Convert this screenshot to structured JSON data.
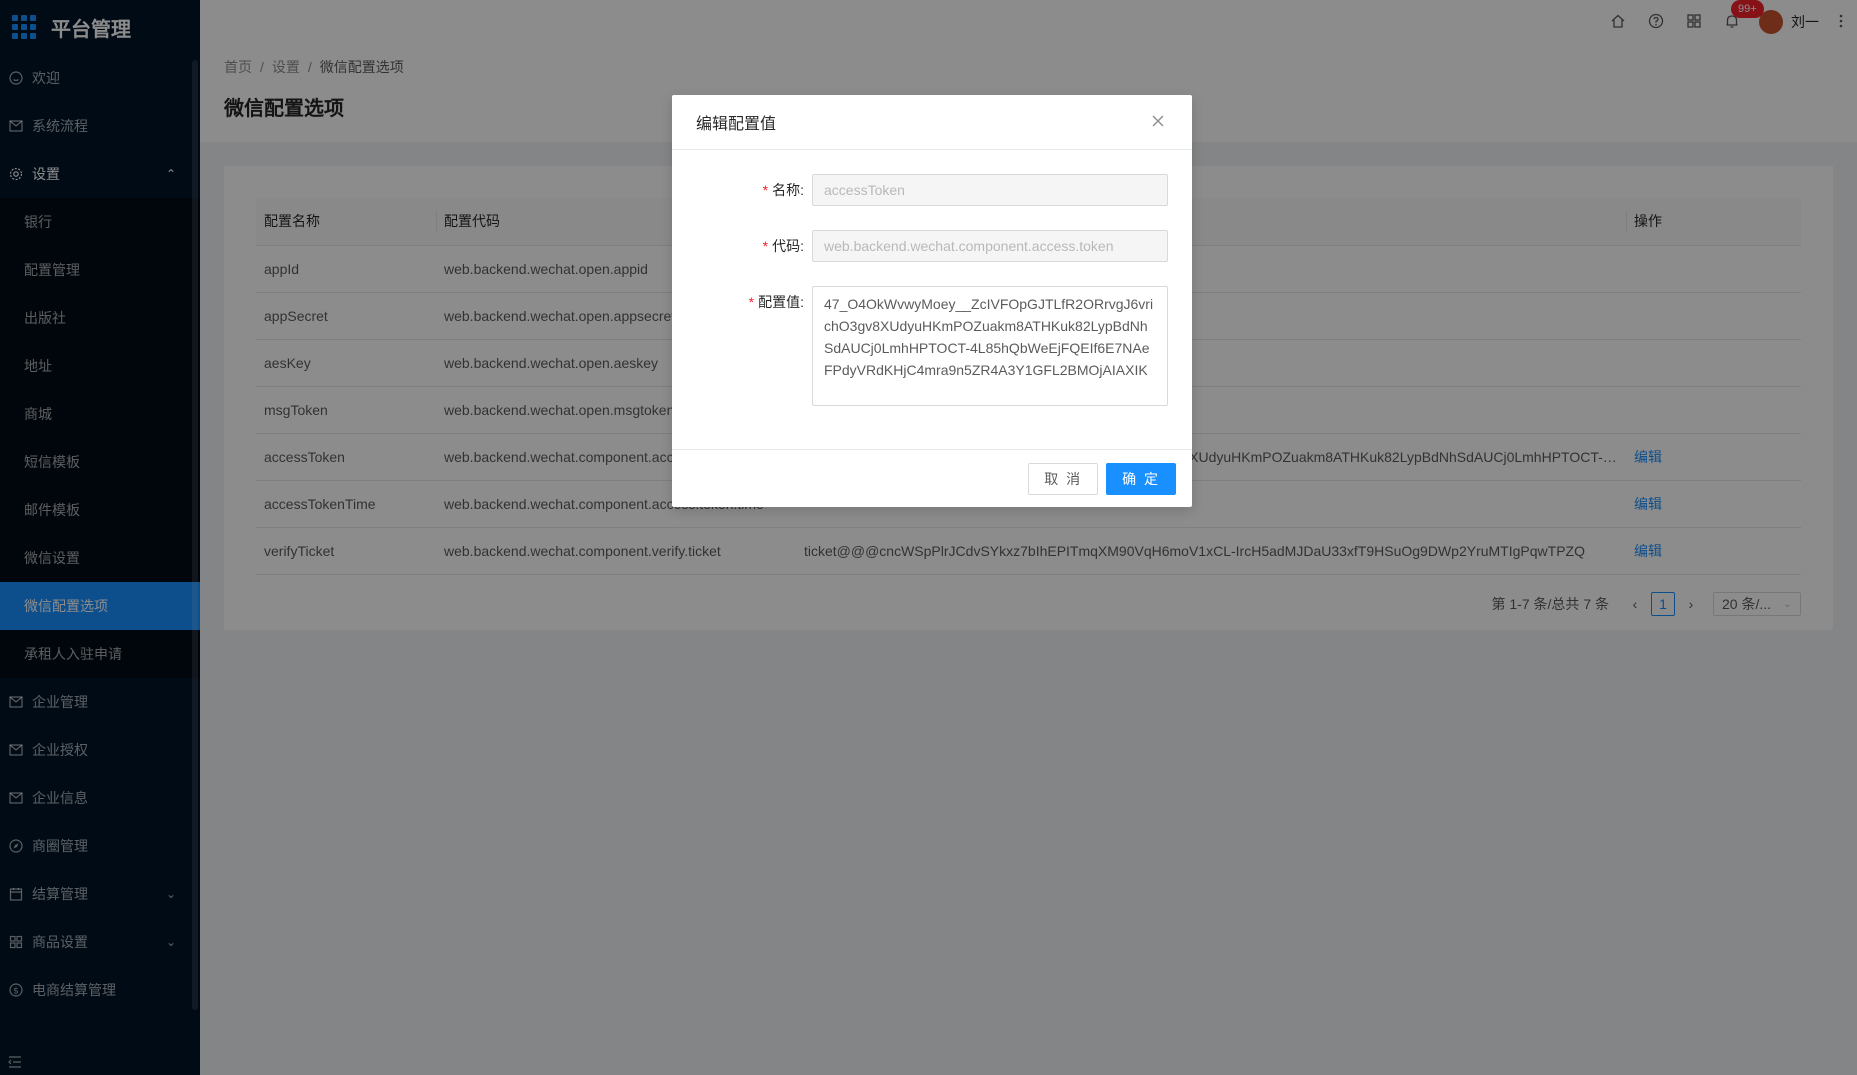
{
  "app": {
    "title": "平台管理"
  },
  "sidebar": {
    "items": [
      {
        "label": "欢迎",
        "icon": "smile-icon"
      },
      {
        "label": "系统流程",
        "icon": "mail-icon"
      },
      {
        "label": "设置",
        "icon": "gear-icon"
      }
    ],
    "settings_children": [
      {
        "label": "银行"
      },
      {
        "label": "配置管理"
      },
      {
        "label": "出版社"
      },
      {
        "label": "地址"
      },
      {
        "label": "商城"
      },
      {
        "label": "短信模板"
      },
      {
        "label": "邮件模板"
      },
      {
        "label": "微信设置"
      },
      {
        "label": "微信配置选项"
      },
      {
        "label": "承租人入驻申请"
      }
    ],
    "items_after": [
      {
        "label": "企业管理",
        "icon": "mail-icon"
      },
      {
        "label": "企业授权",
        "icon": "mail-icon"
      },
      {
        "label": "企业信息",
        "icon": "mail-icon"
      },
      {
        "label": "商圈管理",
        "icon": "compass-icon"
      },
      {
        "label": "结算管理",
        "icon": "calendar-icon"
      },
      {
        "label": "商品设置",
        "icon": "appstore-icon"
      },
      {
        "label": "电商结算管理",
        "icon": "dollar-icon"
      }
    ]
  },
  "header": {
    "badge": "99+",
    "username": "刘一"
  },
  "breadcrumb": [
    "首页",
    "设置",
    "微信配置选项"
  ],
  "page": {
    "title": "微信配置选项"
  },
  "table": {
    "columns": [
      "配置名称",
      "配置代码",
      "",
      "操作"
    ],
    "rows": [
      {
        "name": "appId",
        "code": "web.backend.wechat.open.appid",
        "value": "",
        "action": ""
      },
      {
        "name": "appSecret",
        "code": "web.backend.wechat.open.appsecret",
        "value": "",
        "action": ""
      },
      {
        "name": "aesKey",
        "code": "web.backend.wechat.open.aeskey",
        "value": "",
        "action": ""
      },
      {
        "name": "msgToken",
        "code": "web.backend.wechat.open.msgtoken",
        "value": "",
        "action": ""
      },
      {
        "name": "accessToken",
        "code": "web.backend.wechat.component.access.token",
        "value": "47_O4OkWvwyMoey__ZcIVFOpGJTLfR2ORrvgJ6vrichO3gv8XUdyuHKmPOZuakm8ATHKuk82LypBdNhSdAUCj0LmhHPTOCT-4L85hQbW...",
        "action": "编辑"
      },
      {
        "name": "accessTokenTime",
        "code": "web.backend.wechat.component.access.token.time",
        "value": "",
        "action": "编辑"
      },
      {
        "name": "verifyTicket",
        "code": "web.backend.wechat.component.verify.ticket",
        "value": "ticket@@@cncWSpPlrJCdvSYkxz7bIhEPITmqXM90VqH6moV1xCL-IrcH5adMJDaU33xfT9HSuOg9DWp2YruMTIgPqwTPZQ",
        "action": "编辑"
      }
    ]
  },
  "pagination": {
    "total_text": "第 1-7 条/总共 7 条",
    "current": "1",
    "page_size": "20 条/..."
  },
  "modal": {
    "title": "编辑配置值",
    "name_label": "名称:",
    "name_value": "accessToken",
    "code_label": "代码:",
    "code_value": "web.backend.wechat.component.access.token",
    "value_label": "配置值:",
    "value_text": "47_O4OkWvwyMoey__ZcIVFOpGJTLfR2ORrvgJ6vrichO3gv8XUdyuHKmPOZuakm8ATHKuk82LypBdNhSdAUCj0LmhHPTOCT-4L85hQbWeEjFQEIf6E7NAeFPdyVRdKHjC4mra9n5ZR4A3Y1GFL2BMOjAIAXIK",
    "cancel_label": "取 消",
    "ok_label": "确 定"
  },
  "colors": {
    "sidebar_bg": "#001529",
    "primary": "#1890ff",
    "badge": "#f5222d"
  }
}
